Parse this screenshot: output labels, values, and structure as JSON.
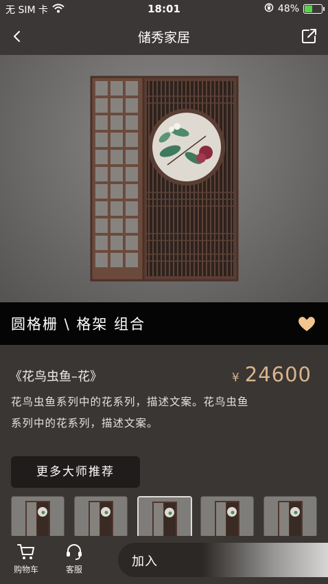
{
  "status_bar": {
    "carrier": "无 SIM 卡",
    "time": "18:01",
    "battery_text": "48%",
    "battery_level": 0.48,
    "icons": [
      "wifi-icon",
      "orientation-lock-icon",
      "battery-icon"
    ]
  },
  "nav": {
    "title": "储秀家居",
    "back_icon": "chevron-left-icon",
    "share_icon": "share-icon"
  },
  "product": {
    "name": "圆格栅 \\ 格架 组合",
    "favorite_icon": "heart-icon",
    "series": "《花鸟虫鱼–花》",
    "currency": "¥",
    "price": "24600",
    "description_line1": "花鸟虫鱼系列中的花系列，描述文案。花鸟虫鱼",
    "description_line2": "系列中的花系列，描述文案。"
  },
  "recommend": {
    "button_label": "更多大师推荐",
    "thumb_count": 5,
    "selected_index": 2
  },
  "bottom_bar": {
    "cart_label": "购物车",
    "cart_icon": "cart-icon",
    "service_label": "客服",
    "service_icon": "headset-icon",
    "add_button_label": "加入"
  },
  "colors": {
    "accent_price": "#d8b58c",
    "heart": "#f2c58f",
    "background": "#3a3634",
    "title_band": "#050505"
  }
}
